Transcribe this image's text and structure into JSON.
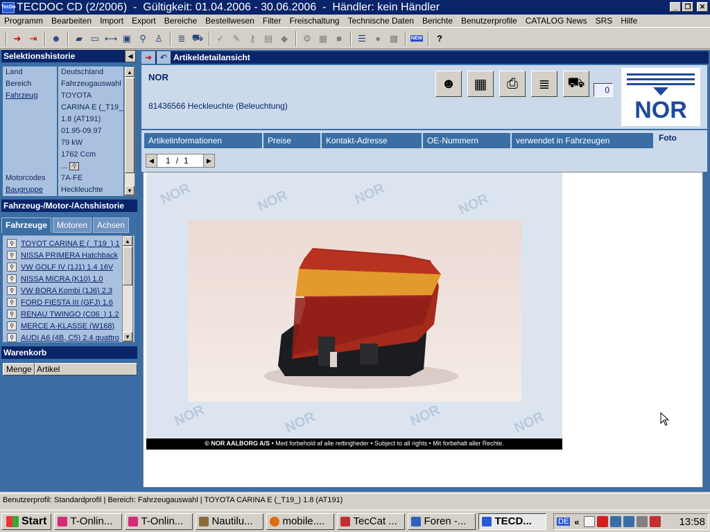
{
  "window": {
    "app_icon_text": "TecDo",
    "title": "TECDOC CD (2/2006)  -  Gültigkeit: 01.04.2006 - 30.06.2006  -  Händler: kein Händler",
    "minimize": "_",
    "restore": "❐",
    "close": "✕"
  },
  "menu": [
    "Programm",
    "Bearbeiten",
    "Import",
    "Export",
    "Bereiche",
    "Bestellwesen",
    "Filter",
    "Freischaltung",
    "Technische Daten",
    "Berichte",
    "Benutzerprofile",
    "CATALOG News",
    "SRS",
    "Hilfe"
  ],
  "toolbar": {
    "new_badge": "NEW",
    "help": "?"
  },
  "left": {
    "selection_history": {
      "title": "Selektionshistorie",
      "rows": [
        {
          "key": "Land",
          "value": "Deutschland",
          "link": false
        },
        {
          "key": "Bereich",
          "value": "Fahrzeugauswahl",
          "link": false
        },
        {
          "key": "Fahrzeug",
          "value": "TOYOTA",
          "link": true
        },
        {
          "key": "",
          "value": "CARINA E (_T19_)",
          "link": false
        },
        {
          "key": "",
          "value": "1.8  (AT191)",
          "link": false
        },
        {
          "key": "",
          "value": "01.95-09.97",
          "link": false
        },
        {
          "key": "",
          "value": "79 kW",
          "link": false
        },
        {
          "key": "",
          "value": "1762 Ccm",
          "link": false
        },
        {
          "key": "",
          "value": "...",
          "link": false
        },
        {
          "key": "Motorcodes",
          "value": "7A-FE",
          "link": false
        },
        {
          "key": "Baugruppe",
          "value": "Heckleuchte",
          "link": true
        }
      ]
    },
    "vehicle_history": {
      "title": "Fahrzeug-/Motor-/Achshistorie",
      "tabs": [
        "Fahrzeuge",
        "Motoren",
        "Achsen"
      ],
      "items": [
        "TOYOT CARINA E (_T19_) 1",
        "NISSA PRIMERA Hatchback",
        "VW GOLF IV (1J1) 1.4 16V",
        "NISSA MICRA (K10) 1.0",
        "VW BORA Kombi (1J6) 2.3",
        "FORD FIESTA III (GFJ) 1.6",
        "RENAU TWINGO (C06_) 1.2",
        "MERCE A-KLASSE (W168)",
        "AUDI A6 (4B, C5) 2.4 quattro"
      ]
    },
    "cart": {
      "title": "Warenkorb",
      "col_qty": "Menge",
      "col_article": "Artikel"
    }
  },
  "detail": {
    "header_title": "Artikeldetailansicht",
    "brand": "NOR",
    "article": "81436566 Heckleuchte (Beleuchtung)",
    "cart_count": "0",
    "logo_text": "NOR",
    "tabs": [
      "Artikelinformationen",
      "Preise",
      "Kontakt-Adresse",
      "OE-Nummern",
      "verwendet in Fahrzeugen",
      "Foto"
    ],
    "active_tab": "Foto",
    "pager": {
      "current": "1",
      "sep": "/",
      "total": "1"
    },
    "photo_caption_brand": "© NOR AALBORG A/S",
    "photo_caption_text": " • Med forbehold af alle rettingheder • Subject to all rights • Mit forbehalt aller Rechte.",
    "watermark": "NOR"
  },
  "status": "Benutzerprofil: Standardprofil | Bereich: Fahrzeugauswahl | TOYOTA CARINA E (_T19_) 1.8  (AT191)",
  "taskbar": {
    "start": "Start",
    "tasks": [
      {
        "label": "T-Onlin...",
        "color": "#d42b76"
      },
      {
        "label": "T-Onlin...",
        "color": "#d42b76"
      },
      {
        "label": "Nautilu...",
        "color": "#8a6b3a"
      },
      {
        "label": "mobile....",
        "color": "#e06a10"
      },
      {
        "label": "TecCat ...",
        "color": "#c03030"
      },
      {
        "label": "Foren -...",
        "color": "#3060c0"
      },
      {
        "label": "TECD...",
        "color": "#2a5bd7"
      }
    ],
    "lang": "DE",
    "tray_chevron": "«",
    "clock": "13:58"
  }
}
